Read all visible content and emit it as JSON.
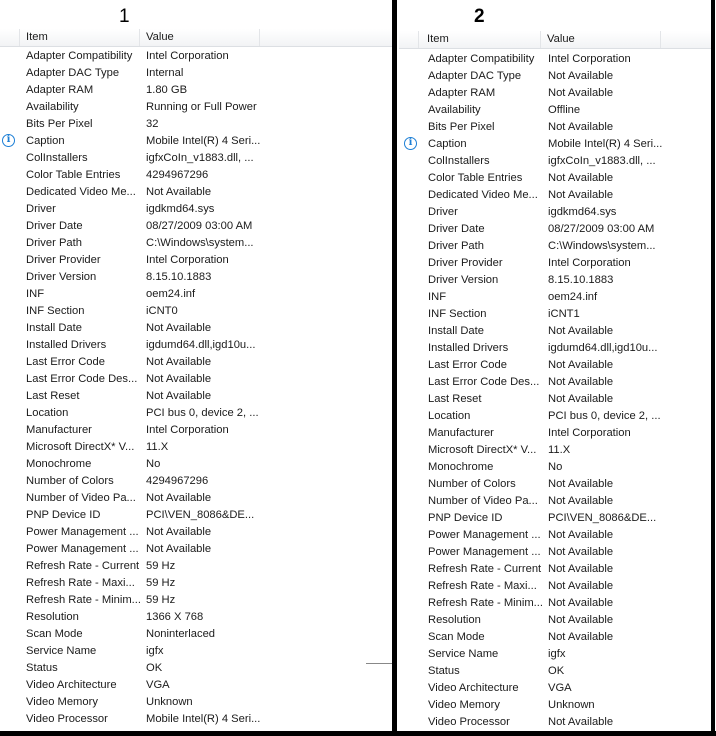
{
  "columns": {
    "item": "Item",
    "value": "Value"
  },
  "panels": [
    {
      "label": "1",
      "rows": [
        {
          "item": "Adapter Compatibility",
          "value": "Intel Corporation"
        },
        {
          "item": "Adapter DAC Type",
          "value": "Internal"
        },
        {
          "item": "Adapter RAM",
          "value": "1.80 GB"
        },
        {
          "item": "Availability",
          "value": "Running or Full Power"
        },
        {
          "item": "Bits Per Pixel",
          "value": "32"
        },
        {
          "item": "Caption",
          "value": "Mobile Intel(R) 4 Seri...",
          "icon": "info-icon"
        },
        {
          "item": "ColInstallers",
          "value": "igfxCoIn_v1883.dll, ..."
        },
        {
          "item": "Color Table Entries",
          "value": "4294967296"
        },
        {
          "item": "Dedicated Video Me...",
          "value": "Not Available"
        },
        {
          "item": "Driver",
          "value": "igdkmd64.sys"
        },
        {
          "item": "Driver Date",
          "value": "08/27/2009 03:00 AM"
        },
        {
          "item": "Driver Path",
          "value": "C:\\Windows\\system..."
        },
        {
          "item": "Driver Provider",
          "value": "Intel Corporation"
        },
        {
          "item": "Driver Version",
          "value": "8.15.10.1883"
        },
        {
          "item": "INF",
          "value": "oem24.inf"
        },
        {
          "item": "INF Section",
          "value": "iCNT0"
        },
        {
          "item": "Install Date",
          "value": "Not Available"
        },
        {
          "item": "Installed Drivers",
          "value": "igdumd64.dll,igd10u..."
        },
        {
          "item": "Last Error Code",
          "value": "Not Available"
        },
        {
          "item": "Last Error Code Des...",
          "value": "Not Available"
        },
        {
          "item": "Last Reset",
          "value": "Not Available"
        },
        {
          "item": "Location",
          "value": "PCI bus 0, device 2, ..."
        },
        {
          "item": "Manufacturer",
          "value": "Intel Corporation"
        },
        {
          "item": "Microsoft DirectX* V...",
          "value": "11.X"
        },
        {
          "item": "Monochrome",
          "value": "No"
        },
        {
          "item": "Number of Colors",
          "value": "4294967296"
        },
        {
          "item": "Number of Video Pa...",
          "value": "Not Available"
        },
        {
          "item": "PNP Device ID",
          "value": "PCI\\VEN_8086&DE..."
        },
        {
          "item": "Power Management ...",
          "value": "Not Available"
        },
        {
          "item": "Power Management ...",
          "value": "Not Available"
        },
        {
          "item": "Refresh Rate - Current",
          "value": "59 Hz"
        },
        {
          "item": "Refresh Rate - Maxi...",
          "value": "59 Hz"
        },
        {
          "item": "Refresh Rate - Minim...",
          "value": "59 Hz"
        },
        {
          "item": "Resolution",
          "value": "1366 X 768"
        },
        {
          "item": "Scan Mode",
          "value": "Noninterlaced"
        },
        {
          "item": "Service Name",
          "value": "igfx"
        },
        {
          "item": "Status",
          "value": "OK"
        },
        {
          "item": "Video Architecture",
          "value": "VGA"
        },
        {
          "item": "Video Memory",
          "value": "Unknown"
        },
        {
          "item": "Video Processor",
          "value": "Mobile Intel(R) 4 Seri..."
        }
      ]
    },
    {
      "label": "2",
      "rows": [
        {
          "item": "Adapter Compatibility",
          "value": "Intel Corporation"
        },
        {
          "item": "Adapter DAC Type",
          "value": "Not Available"
        },
        {
          "item": "Adapter RAM",
          "value": "Not Available"
        },
        {
          "item": "Availability",
          "value": "Offline"
        },
        {
          "item": "Bits Per Pixel",
          "value": "Not Available"
        },
        {
          "item": "Caption",
          "value": "Mobile Intel(R) 4 Seri...",
          "icon": "info-icon"
        },
        {
          "item": "ColInstallers",
          "value": "igfxCoIn_v1883.dll, ..."
        },
        {
          "item": "Color Table Entries",
          "value": "Not Available"
        },
        {
          "item": "Dedicated Video Me...",
          "value": "Not Available"
        },
        {
          "item": "Driver",
          "value": "igdkmd64.sys"
        },
        {
          "item": "Driver Date",
          "value": "08/27/2009 03:00 AM"
        },
        {
          "item": "Driver Path",
          "value": "C:\\Windows\\system..."
        },
        {
          "item": "Driver Provider",
          "value": "Intel Corporation"
        },
        {
          "item": "Driver Version",
          "value": "8.15.10.1883"
        },
        {
          "item": "INF",
          "value": "oem24.inf"
        },
        {
          "item": "INF Section",
          "value": "iCNT1"
        },
        {
          "item": "Install Date",
          "value": "Not Available"
        },
        {
          "item": "Installed Drivers",
          "value": "igdumd64.dll,igd10u..."
        },
        {
          "item": "Last Error Code",
          "value": "Not Available"
        },
        {
          "item": "Last Error Code Des...",
          "value": "Not Available"
        },
        {
          "item": "Last Reset",
          "value": "Not Available"
        },
        {
          "item": "Location",
          "value": "PCI bus 0, device 2, ..."
        },
        {
          "item": "Manufacturer",
          "value": "Intel Corporation"
        },
        {
          "item": "Microsoft DirectX* V...",
          "value": "11.X"
        },
        {
          "item": "Monochrome",
          "value": "No"
        },
        {
          "item": "Number of Colors",
          "value": "Not Available"
        },
        {
          "item": "Number of Video Pa...",
          "value": "Not Available"
        },
        {
          "item": "PNP Device ID",
          "value": "PCI\\VEN_8086&DE..."
        },
        {
          "item": "Power Management ...",
          "value": "Not Available"
        },
        {
          "item": "Power Management ...",
          "value": "Not Available"
        },
        {
          "item": "Refresh Rate - Current",
          "value": "Not Available"
        },
        {
          "item": "Refresh Rate - Maxi...",
          "value": "Not Available"
        },
        {
          "item": "Refresh Rate - Minim...",
          "value": "Not Available"
        },
        {
          "item": "Resolution",
          "value": "Not Available"
        },
        {
          "item": "Scan Mode",
          "value": "Not Available"
        },
        {
          "item": "Service Name",
          "value": "igfx"
        },
        {
          "item": "Status",
          "value": "OK"
        },
        {
          "item": "Video Architecture",
          "value": "VGA"
        },
        {
          "item": "Video Memory",
          "value": "Unknown"
        },
        {
          "item": "Video Processor",
          "value": "Not Available"
        }
      ]
    }
  ],
  "icons": {
    "info": "i"
  }
}
